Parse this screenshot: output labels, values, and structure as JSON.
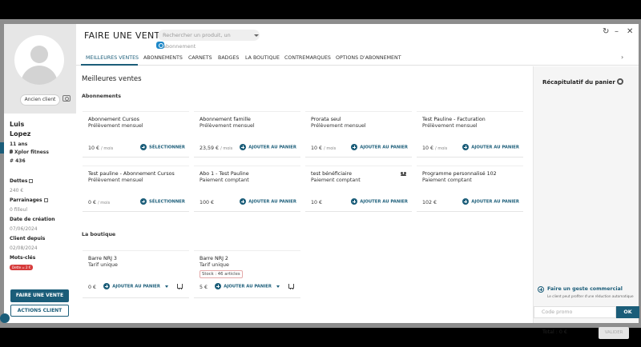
{
  "profile": {
    "client_status": "Ancien client",
    "first_name": "Luis",
    "last_name": "Lopez",
    "age": "11 ans",
    "location": "Xplor fitness",
    "member_id": "# 436",
    "debts_label": "Dettes",
    "debts_value": "240 €",
    "sponsorships_label": "Parrainages",
    "sponsorships_value": "0 filleul",
    "created_label": "Date de création",
    "created_value": "07/06/2024",
    "client_since_label": "Client depuis",
    "client_since_value": "02/08/2024",
    "keywords_label": "Mots-clés",
    "keyword_tag": "Dette = 2 €",
    "new_sale_button": "FAIRE UNE VENTE",
    "client_actions_button": "ACTIONS CLIENT"
  },
  "header": {
    "title": "FAIRE UNE VENTE",
    "search_placeholder": "Rechercher un produit, un abonnement"
  },
  "tabs": [
    {
      "label": "MEILLEURES VENTES",
      "active": true
    },
    {
      "label": "ABONNEMENTS"
    },
    {
      "label": "CARNETS"
    },
    {
      "label": "BADGES"
    },
    {
      "label": "LA BOUTIQUE"
    },
    {
      "label": "CONTREMARQUES"
    },
    {
      "label": "OPTIONS D'ABONNEMENT"
    }
  ],
  "content": {
    "title": "Meilleures ventes",
    "subscriptions_title": "Abonnements",
    "shop_title": "La boutique",
    "subscriptions": [
      {
        "name": "Abonnement Cursos",
        "type": "Prélèvement mensuel",
        "price": "10 €",
        "unit": "/ mois",
        "action": "SÉLECTIONNER"
      },
      {
        "name": "Abonnement famille",
        "type": "Prélèvement mensuel",
        "price": "23,59 €",
        "unit": "/ mois",
        "action": "AJOUTER AU PANIER"
      },
      {
        "name": "Prorata seul",
        "type": "Prélèvement mensuel",
        "price": "10 €",
        "unit": "/ mois",
        "action": "AJOUTER AU PANIER"
      },
      {
        "name": "Test Pauline - Facturation",
        "type": "Prélèvement mensuel",
        "price": "10 €",
        "unit": "/ mois",
        "action": "AJOUTER AU PANIER"
      },
      {
        "name": "Test pauline - Abonnement Cursos",
        "type": "Prélèvement mensuel",
        "price": "0 €",
        "unit": "/ mois",
        "action": "SÉLECTIONNER"
      },
      {
        "name": "Abo 1 - Test Pauline",
        "type": "Paiement comptant",
        "price": "100 €",
        "unit": "",
        "action": "AJOUTER AU PANIER"
      },
      {
        "name": "test bénéficiaire",
        "type": "Paiement comptant",
        "price": "10 €",
        "unit": "",
        "action": "AJOUTER AU PANIER"
      },
      {
        "name": "Programme personnalisé 102",
        "type": "Paiement comptant",
        "price": "102 €",
        "unit": "",
        "action": "AJOUTER AU PANIER"
      }
    ],
    "shop": [
      {
        "name": "Barre NRJ 3",
        "type": "Tarif unique",
        "price": "0 €",
        "action": "AJOUTER AU PANIER"
      },
      {
        "name": "Barre NRJ 2",
        "type": "Tarif unique",
        "stock": "Stock : 46 articles",
        "price": "5 €",
        "action": "AJOUTER AU PANIER"
      }
    ]
  },
  "cart": {
    "title": "Récapitulatif du panier",
    "gesture_title": "Faire un geste commercial",
    "gesture_subtitle": "Le client peut profiter d'une réduction automatique",
    "promo_placeholder": "Code promo",
    "ok_label": "OK",
    "total": "Total : 0 €",
    "validate_label": "VALIDER"
  },
  "colors": {
    "primary": "#1b5d79",
    "danger": "#d63b3b",
    "accent_blue": "#1e88c8"
  }
}
